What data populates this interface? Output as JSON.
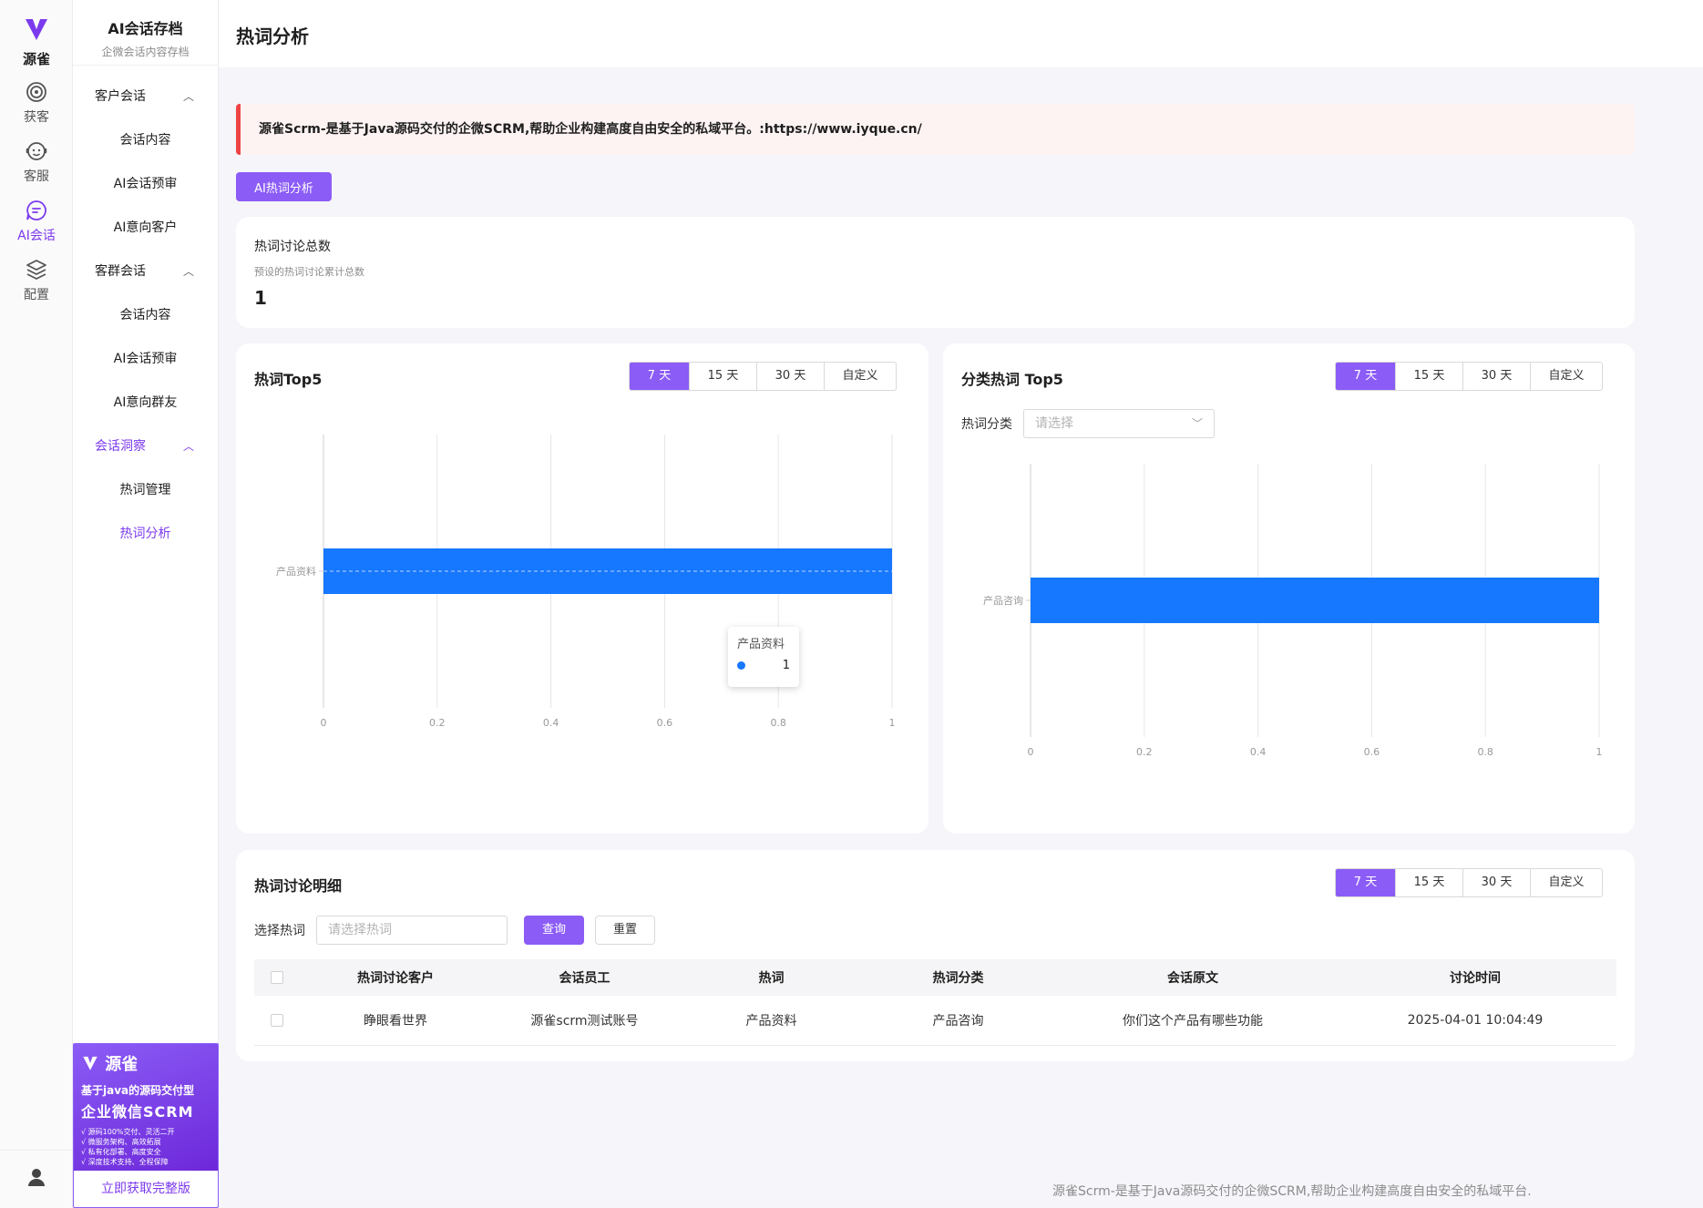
{
  "rail": {
    "brand": "源雀",
    "items": [
      {
        "label": "获客",
        "icon": "target-icon"
      },
      {
        "label": "客服",
        "icon": "support-icon"
      },
      {
        "label": "AI会话",
        "icon": "chat-icon"
      },
      {
        "label": "配置",
        "icon": "layers-icon"
      }
    ],
    "active_index": 2
  },
  "menu": {
    "title": "AI会话存档",
    "subtitle": "企微会话内容存档",
    "groups": [
      {
        "label": "客户会话",
        "items": [
          "会话内容",
          "AI会话预审",
          "AI意向客户"
        ]
      },
      {
        "label": "客群会话",
        "items": [
          "会话内容",
          "AI会话预审",
          "AI意向群友"
        ]
      },
      {
        "label": "会话洞察",
        "items": [
          "热词管理",
          "热词分析"
        ]
      }
    ],
    "active_group": "会话洞察",
    "active_item": "热词分析"
  },
  "promo": {
    "brand": "源雀",
    "line1": "基于java的源码交付型",
    "line2": "企业微信SCRM",
    "bullets": [
      "√ 源码100%交付、灵活二开",
      "√ 微服务架构、高效拓展",
      "√ 私有化部署、高度安全",
      "√ 深度技术支持、全程保障"
    ],
    "cta": "立即获取完整版"
  },
  "page": {
    "title": "热词分析",
    "notice": "源雀Scrm-是基于Java源码交付的企微SCRM,帮助企业构建高度自由安全的私域平台。:https://www.iyque.cn/",
    "ai_button": "AI热词分析"
  },
  "summary": {
    "title": "热词讨论总数",
    "subtitle": "预设的热词讨论累计总数",
    "value": "1"
  },
  "ranges": [
    "7 天",
    "15 天",
    "30 天",
    "自定义"
  ],
  "top5": {
    "title": "热词Top5",
    "selected_range": "7 天"
  },
  "category_top5": {
    "title": "分类热词 Top5",
    "selected_range": "7 天",
    "filter_label": "热词分类",
    "filter_placeholder": "请选择"
  },
  "detail": {
    "title": "热词讨论明细",
    "selected_range": "7 天",
    "search_label": "选择热词",
    "search_placeholder": "请选择热词",
    "query_button": "查询",
    "reset_button": "重置",
    "columns": [
      "热词讨论客户",
      "会话员工",
      "热词",
      "热词分类",
      "会话原文",
      "讨论时间"
    ],
    "rows": [
      [
        "睁眼看世界",
        "源雀scrm测试账号",
        "产品资料",
        "产品咨询",
        "你们这个产品有哪些功能",
        "2025-04-01 10:04:49"
      ]
    ]
  },
  "tooltip": {
    "label": "产品资料",
    "value": "1"
  },
  "chart_data": [
    {
      "type": "bar",
      "orientation": "horizontal",
      "categories": [
        "产品资料"
      ],
      "values": [
        1
      ],
      "xlim": [
        0,
        1
      ],
      "xticks": [
        "0",
        "0.2",
        "0.4",
        "0.6",
        "0.8",
        "1"
      ],
      "color": "#1677ff",
      "grid": true
    },
    {
      "type": "bar",
      "orientation": "horizontal",
      "categories": [
        "产品咨询"
      ],
      "values": [
        1
      ],
      "xlim": [
        0,
        1
      ],
      "xticks": [
        "0",
        "0.2",
        "0.4",
        "0.6",
        "0.8",
        "1"
      ],
      "color": "#1677ff",
      "grid": true
    }
  ],
  "footer": "源雀Scrm-是基于Java源码交付的企微SCRM,帮助企业构建高度自由安全的私域平台."
}
